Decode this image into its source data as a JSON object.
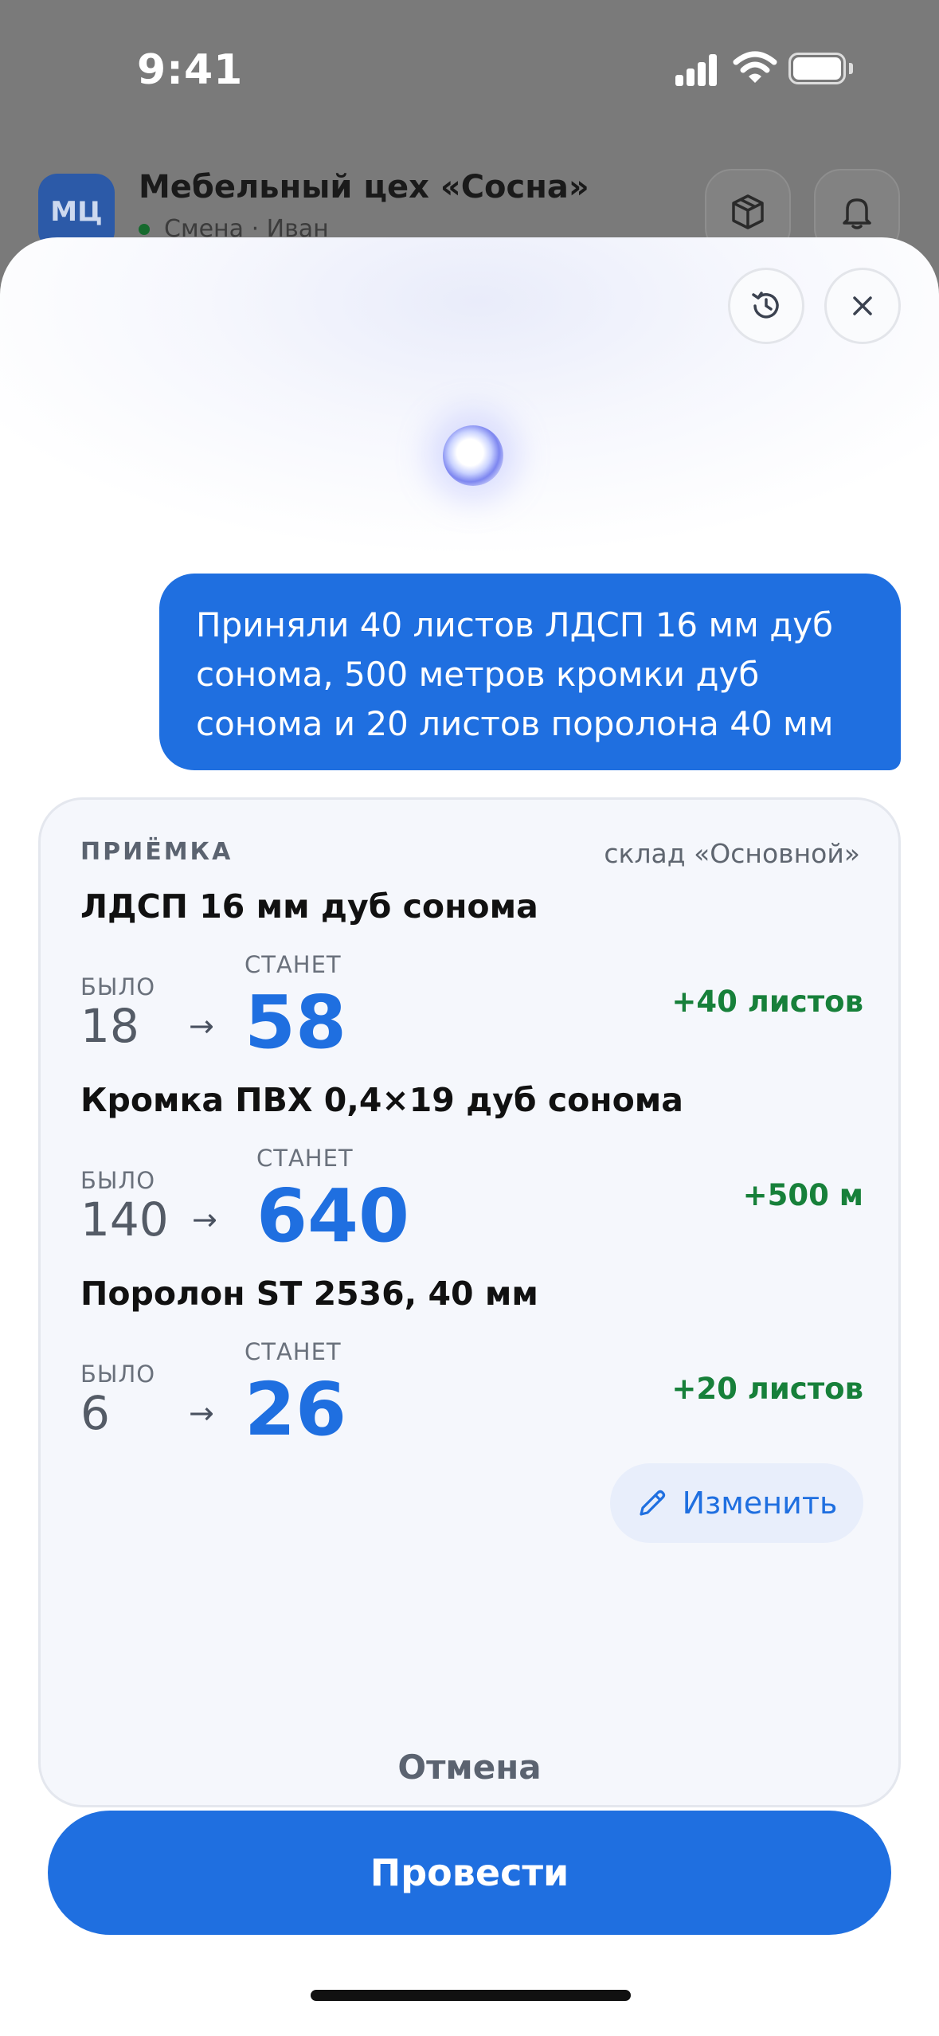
{
  "status_bar": {
    "time": "9:41"
  },
  "background_header": {
    "avatar_initials": "МЦ",
    "company_name": "Мебельный цех «Сосна»",
    "shift_text": "Смена · Иван",
    "icons": [
      "box-icon",
      "bell-icon"
    ]
  },
  "sheet": {
    "icons": [
      "history-icon",
      "close-icon"
    ],
    "user_message": "Приняли 40 листов ЛДСП 16 мм дуб сонома, 500 метров кромки дуб сонома и 20 листов поролона 40 мм",
    "card": {
      "label": "ПРИЁМКА",
      "warehouse": "склад «Основной»",
      "was_label": "БЫЛО",
      "will_label": "СТАНЕТ",
      "arrow": "→",
      "items": [
        {
          "name": "ЛДСП 16 мм дуб сонома",
          "was": "18",
          "will": "58",
          "delta": "+40 листов"
        },
        {
          "name": "Кромка ПВХ 0,4×19 дуб сонома",
          "was": "140",
          "will": "640",
          "delta": "+500 м"
        },
        {
          "name": "Поролон ST 2536, 40 мм",
          "was": "6",
          "will": "26",
          "delta": "+20 листов"
        }
      ],
      "edit_label": "Изменить"
    },
    "cancel_label": "Отмена",
    "submit_label": "Провести"
  },
  "colors": {
    "accent": "#1f6fe0",
    "positive": "#17803a",
    "bubble": "#1f6fe0"
  }
}
